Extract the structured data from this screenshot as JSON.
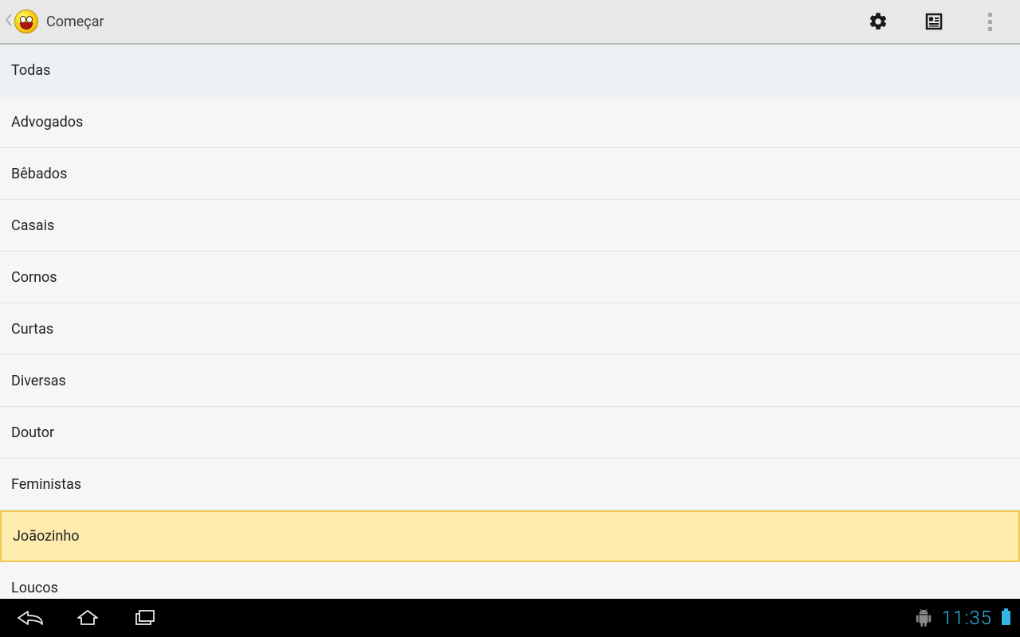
{
  "header": {
    "title": "Começar"
  },
  "list": {
    "items": [
      {
        "label": "Todas",
        "first": true,
        "selected": false
      },
      {
        "label": "Advogados",
        "first": false,
        "selected": false
      },
      {
        "label": "Bêbados",
        "first": false,
        "selected": false
      },
      {
        "label": "Casais",
        "first": false,
        "selected": false
      },
      {
        "label": "Cornos",
        "first": false,
        "selected": false
      },
      {
        "label": "Curtas",
        "first": false,
        "selected": false
      },
      {
        "label": "Diversas",
        "first": false,
        "selected": false
      },
      {
        "label": "Doutor",
        "first": false,
        "selected": false
      },
      {
        "label": "Feministas",
        "first": false,
        "selected": false
      },
      {
        "label": "Joãozinho",
        "first": false,
        "selected": true
      },
      {
        "label": "Loucos",
        "first": false,
        "selected": false
      }
    ]
  },
  "status": {
    "time": "11:35"
  }
}
